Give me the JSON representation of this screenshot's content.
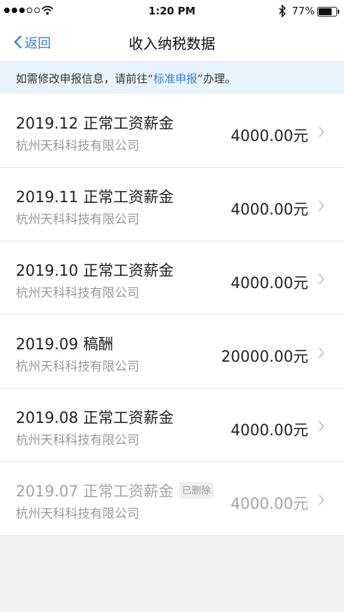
{
  "status_bar": {
    "time": "1:20 PM",
    "battery_text": "77%",
    "battery_level": 0.77,
    "signal_bars_filled": 3,
    "signal_bars_total": 5,
    "icons": [
      "signal-icon",
      "wifi-icon",
      "bluetooth-icon",
      "battery-icon"
    ]
  },
  "nav": {
    "back_label": "返回",
    "title": "收入纳税数据"
  },
  "notice": {
    "prefix": "如需修改申报信息，请前往“",
    "link": "标准申报",
    "suffix": "”办理。"
  },
  "records": [
    {
      "period": "2019.12",
      "type": "正常工资薪金",
      "title": "2019.12 正常工资薪金",
      "company": "杭州天科科技有限公司",
      "amount": "4000.00元",
      "badge": ""
    },
    {
      "period": "2019.11",
      "type": "正常工资薪金",
      "title": "2019.11 正常工资薪金",
      "company": "杭州天科科技有限公司",
      "amount": "4000.00元",
      "badge": ""
    },
    {
      "period": "2019.10",
      "type": "正常工资薪金",
      "title": "2019.10 正常工资薪金",
      "company": "杭州天科科技有限公司",
      "amount": "4000.00元",
      "badge": ""
    },
    {
      "period": "2019.09",
      "type": "稿酬",
      "title": "2019.09 稿酬",
      "company": "杭州天科科技有限公司",
      "amount": "20000.00元",
      "badge": ""
    },
    {
      "period": "2019.08",
      "type": "正常工资薪金",
      "title": "2019.08 正常工资薪金",
      "company": "杭州天科科技有限公司",
      "amount": "4000.00元",
      "badge": ""
    },
    {
      "period": "2019.07",
      "type": "正常工资薪金",
      "title": "2019.07 正常工资薪金",
      "company": "杭州天科科技有限公司",
      "amount": "4000.00元",
      "badge": "已删除"
    }
  ],
  "colors": {
    "accent": "#2e7cf6",
    "notice_bg": "#e8f3fd",
    "page_bg": "#f2f2f5",
    "muted_text": "#9a9a9a"
  }
}
